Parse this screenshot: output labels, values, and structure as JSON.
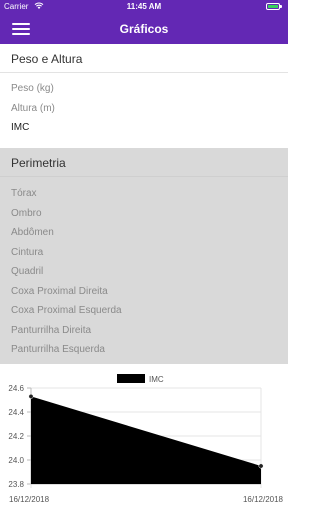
{
  "status_bar": {
    "carrier": "Carrier",
    "time": "11:45 AM"
  },
  "nav": {
    "title": "Gráficos",
    "menu_icon": "hamburger-menu-icon"
  },
  "sections": [
    {
      "title": "Peso e Altura",
      "items": [
        {
          "label": "Peso (kg)",
          "selected": false
        },
        {
          "label": "Altura (m)",
          "selected": false
        },
        {
          "label": "IMC",
          "selected": true
        }
      ]
    },
    {
      "title": "Perimetria",
      "items": [
        {
          "label": "Tórax",
          "selected": false
        },
        {
          "label": "Ombro",
          "selected": false
        },
        {
          "label": "Abdômen",
          "selected": false
        },
        {
          "label": "Cintura",
          "selected": false
        },
        {
          "label": "Quadril",
          "selected": false
        },
        {
          "label": "Coxa Proximal Direita",
          "selected": false
        },
        {
          "label": "Coxa Proximal Esquerda",
          "selected": false
        },
        {
          "label": "Panturrilha Direita",
          "selected": false
        },
        {
          "label": "Panturrilha Esquerda",
          "selected": false
        }
      ]
    }
  ],
  "colors": {
    "nav_background": "#6328b4",
    "section_background_gray": "#d9d9d9",
    "chart_fill": "#000000"
  },
  "chart_data": {
    "type": "area",
    "legend": [
      "IMC"
    ],
    "legend_position": "top",
    "x": [
      "16/12/2018",
      "16/12/2018"
    ],
    "series": [
      {
        "name": "IMC",
        "values": [
          24.53,
          23.95
        ]
      }
    ],
    "ylim": [
      23.8,
      24.6
    ],
    "yticks": [
      "24.6",
      "24.4",
      "24.2",
      "24.0",
      "23.8"
    ],
    "grid": true
  }
}
